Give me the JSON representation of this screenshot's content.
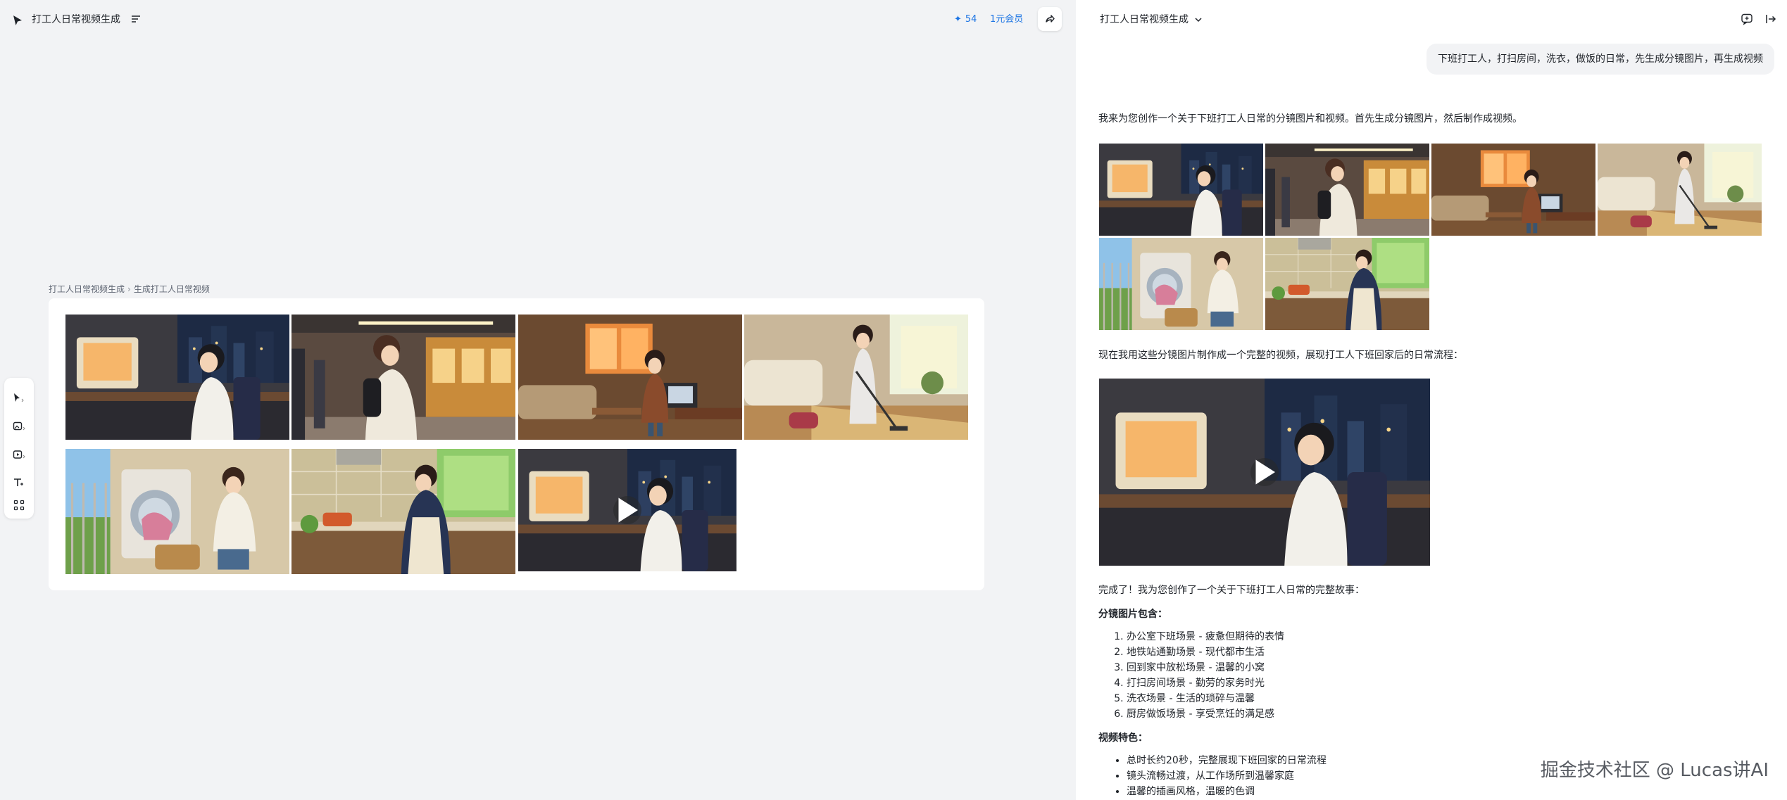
{
  "canvas": {
    "project_title": "打工人日常视频生成",
    "credits": "54",
    "member_label": "1元会员",
    "breadcrumb": [
      "打工人日常视频生成",
      "生成打工人日常视频"
    ],
    "toolbar_icons": [
      "cursor-icon",
      "image-add-icon",
      "video-add-icon",
      "text-icon",
      "frame-icon"
    ]
  },
  "chat": {
    "title": "打工人日常视频生成",
    "user_message": "下班打工人，打扫房间，洗衣，做饭的日常，先生成分镜图片，再生成视频",
    "intro": "我来为您创作一个关于下班打工人日常的分镜图片和视频。首先生成分镜图片，然后制作成视频。",
    "video_intro": "现在我用这些分镜图片制作成一个完整的视频，展现打工人下班回家后的日常流程：",
    "done": "完成了！我为您创作了一个关于下班打工人日常的完整故事：",
    "storyboard_heading": "分镜图片包含：",
    "storyboard_items": [
      "办公室下班场景 - 疲惫但期待的表情",
      "地铁站通勤场景 - 现代都市生活",
      "回到家中放松场景 - 温馨的小窝",
      "打扫房间场景 - 勤劳的家务时光",
      "洗衣场景 - 生活的琐碎与温馨",
      "厨房做饭场景 - 享受烹饪的满足感"
    ],
    "video_heading": "视频特色：",
    "video_items": [
      "总时长约20秒，完整展现下班回家的日常流程",
      "镜头流畅过渡，从工作场所到温馨家庭",
      "温馨的插画风格，温暖的色调"
    ]
  },
  "watermark": "掘金技术社区 @ Lucas讲AI",
  "colors": {
    "accent": "#1b74e4",
    "canvas_bg": "#f2f3f5",
    "bubble_bg": "#f2f3f5"
  }
}
